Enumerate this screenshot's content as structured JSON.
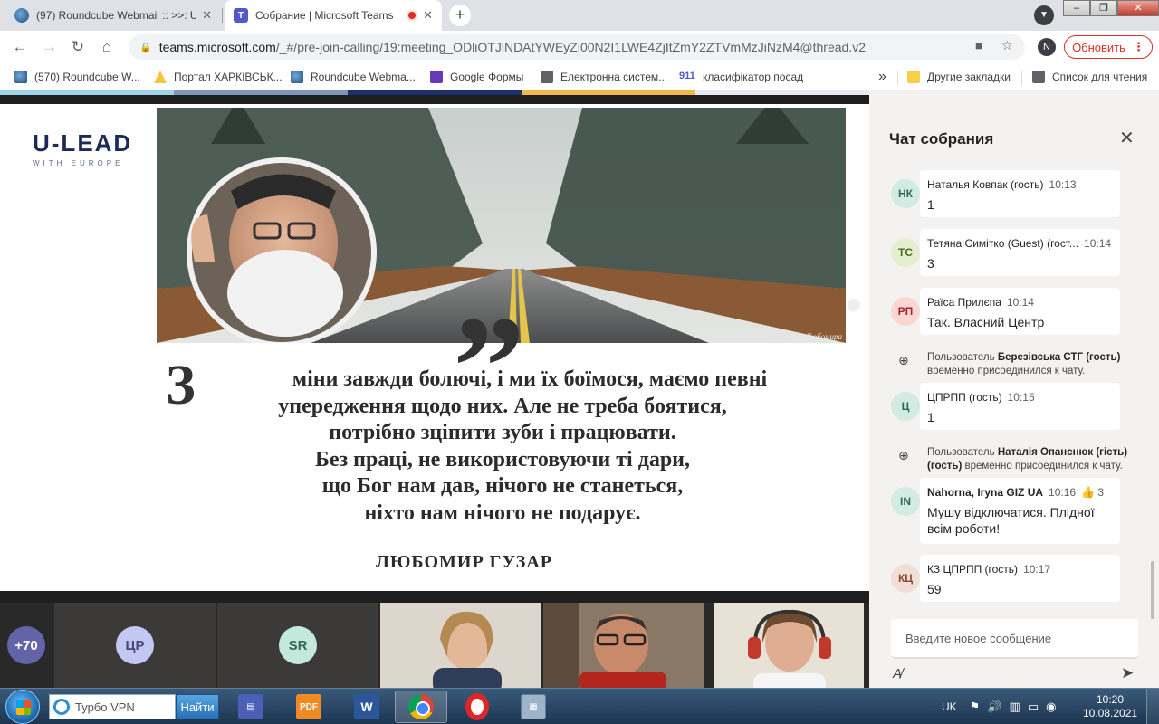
{
  "browser": {
    "tabs": [
      {
        "title": "(97) Roundcube Webmail :: >>: U",
        "icon": "roundcube-icon"
      },
      {
        "title": "Собрание | Microsoft Teams",
        "icon": "teams-icon",
        "recording": true
      }
    ],
    "url_host": "teams.microsoft.com",
    "url_path": "/_#/pre-join-calling/19:meeting_ODliOTJlNDAtYWEyZi00N2I1LWE4ZjItZmY2ZTVmMzJiNzM4@thread.v2",
    "profile_initial": "N",
    "update_label": "Обновить",
    "bookmarks": [
      {
        "label": "(570) Roundcube W...",
        "icon": "roundcube-icon"
      },
      {
        "label": "Портал ХАРКІВСЬК...",
        "icon": "portal-icon"
      },
      {
        "label": "Roundcube Webma...",
        "icon": "roundcube-icon"
      },
      {
        "label": "Google Формы",
        "icon": "google-forms-icon"
      },
      {
        "label": "Електронна систем...",
        "icon": "globe-icon"
      },
      {
        "label": "класифікатор посад",
        "icon": "911-icon"
      }
    ],
    "bookmarks_overflow": "»",
    "other_bookmarks": "Другие закладки",
    "reading_list": "Список для чтения"
  },
  "slide": {
    "logo_main": "U-LEAD",
    "logo_sub": "WITH EUROPE",
    "hashtag": "#ПоколінняЛюбомира",
    "drop_cap": "З",
    "quote_lines": [
      "міни завжди болючі, і ми їх боїмося, маємо певні",
      "упередження щодо них. Але не треба боятися,",
      "потрібно зціпити зуби і працювати.",
      "Без праці, не використовуючи ті дари,",
      "що Бог нам дав, нічого не станеться,",
      "ніхто нам нічого не подарує."
    ],
    "author": "ЛЮБОМИР ГУЗАР",
    "stripe_colors": [
      "#9fd4e8",
      "#7f95b8",
      "#1f2f6a",
      "#f2b84b",
      "#e8eaef"
    ]
  },
  "participants": {
    "more_count": "+70",
    "tiles": [
      {
        "initials": "ЦР"
      },
      {
        "initials": "SR"
      }
    ]
  },
  "chat": {
    "title": "Чат собрания",
    "messages": [
      {
        "initials": "НК",
        "name": "Наталья Ковпак (гость)",
        "time": "10:13",
        "text": "1",
        "avatar_bg": "#d2ebe3",
        "avatar_fg": "#2f6c54"
      },
      {
        "initials": "TC",
        "name": "Тетяна Симітко (Guest) (гост...",
        "time": "10:14",
        "text": "3",
        "avatar_bg": "#e5eecf",
        "avatar_fg": "#4f6b1f"
      },
      {
        "initials": "РП",
        "name": "Раїса Прилєпа",
        "time": "10:14",
        "text": "Так. Власний Центр",
        "avatar_bg": "#fbd6d3",
        "avatar_fg": "#a4262c"
      },
      {
        "initials": "Ц",
        "name": "ЦПРПП (гость)",
        "time": "10:15",
        "text": "1",
        "avatar_bg": "#d2ebe3",
        "avatar_fg": "#2f6c54"
      },
      {
        "initials": "IN",
        "name": "Nahorna, Iryna GIZ UA",
        "time": "10:16",
        "reaction": "👍 3",
        "text": "Мушу відключатися. Плідної всім роботи!",
        "avatar_bg": "#d2ebe3",
        "avatar_fg": "#2f6c54"
      },
      {
        "initials": "КЦ",
        "name": "КЗ ЦПРПП (гость)",
        "time": "10:17",
        "text": "59",
        "avatar_bg": "#f1dfd7",
        "avatar_fg": "#8a4a33"
      }
    ],
    "system": [
      {
        "prefix": "Пользователь",
        "name": "Березівська СТГ (гость)",
        "suffix": "временно присоединился к чату."
      },
      {
        "prefix": "Пользователь",
        "name": "Наталія Опанснюк (гість) (гость)",
        "suffix": "временно присоединился к чату."
      }
    ],
    "compose_placeholder": "Введите новое сообщение"
  },
  "taskbar": {
    "vpn_text": "Турбо VPN",
    "vpn_button": "Найти",
    "lang": "UK",
    "time": "10:20",
    "date": "10.08.2021"
  }
}
